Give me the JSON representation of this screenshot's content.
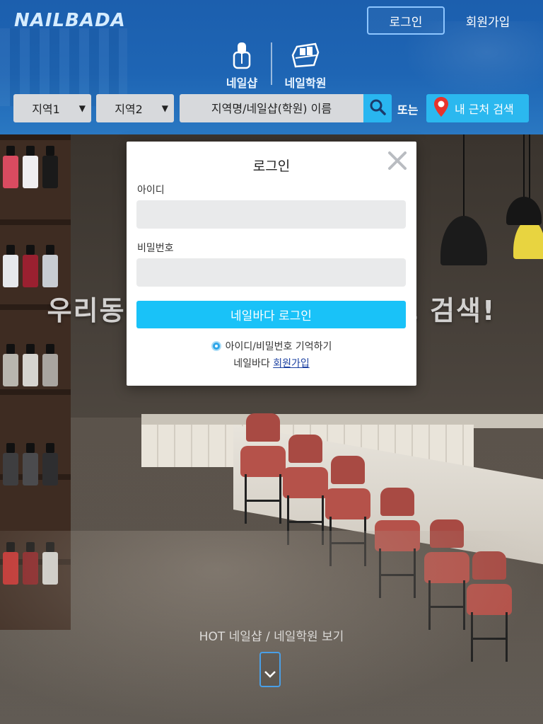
{
  "header": {
    "logo": "NAILBADA",
    "login_label": "로그인",
    "signup_label": "회원가입",
    "categories": [
      {
        "label": "네일샵",
        "icon": "nail-polish-icon"
      },
      {
        "label": "네일학원",
        "icon": "academy-kit-icon"
      }
    ]
  },
  "search": {
    "region1": "지역1",
    "region2": "지역2",
    "dropdown_arrow": "▼",
    "input_placeholder": "지역명/네일샵(학원) 이름",
    "or_text": "또는",
    "nearby_label": "내 근처 검색"
  },
  "hero": {
    "headline": "우리동네 네일샵 지역으로 찾고 검색!",
    "hot_link": "HOT 네일샵 / 네일학원 보기"
  },
  "login_modal": {
    "title": "로그인",
    "id_label": "아이디",
    "id_value": "",
    "pw_label": "비밀번호",
    "pw_value": "",
    "submit_label": "네일바다 로그인",
    "remember_label": "아이디/비밀번호 기억하기",
    "remember_checked": true,
    "signup_prefix": "네일바다",
    "signup_link": "회원가입"
  },
  "colors": {
    "header_blue": "#1e65b4",
    "accent_cyan": "#19c2f8",
    "link_blue": "#1a3fa0"
  }
}
